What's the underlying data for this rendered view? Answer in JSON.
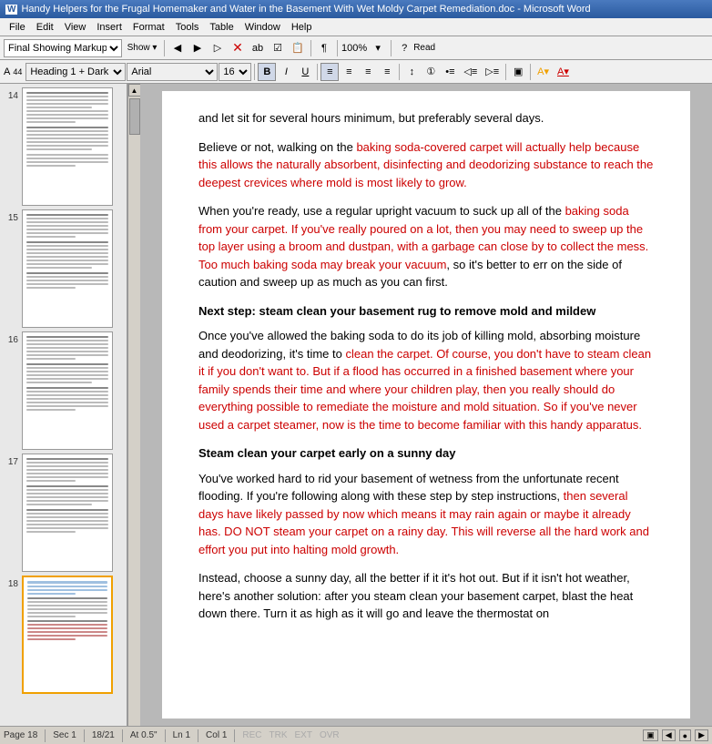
{
  "titlebar": {
    "text": "Handy Helpers for the Frugal Homemaker and Water in the Basement With Wet Moldy Carpet Remediation.doc - Microsoft Word",
    "icon": "W"
  },
  "menubar": {
    "items": [
      "File",
      "Edit",
      "View",
      "Insert",
      "Format",
      "Tools",
      "Table",
      "Window",
      "Help"
    ]
  },
  "toolbar1": {
    "dropdown_value": "Final Showing Markup",
    "show_label": "Show ▾"
  },
  "toolbar2": {
    "style_value": "Heading 1 + Dark",
    "font_value": "Arial",
    "size_value": "16",
    "bold_label": "B",
    "italic_label": "I",
    "underline_label": "U"
  },
  "pages": [
    {
      "num": "14",
      "active": false
    },
    {
      "num": "15",
      "active": false
    },
    {
      "num": "16",
      "active": false
    },
    {
      "num": "17",
      "active": false
    },
    {
      "num": "18",
      "active": true
    }
  ],
  "content": {
    "para1": "and let sit for several hours minimum, but preferably several days.",
    "para2_1": "Believe or not, walking on the baking soda-covered carpet will actually help because this allows the naturally absorbent, disinfecting and deodorizing substance to reach the deepest crevices where mold is most likely to grow.",
    "para3_1": "When you're ready, use a regular upright vacuum to suck up all of the baking soda from your carpet. If you've really poured on a lot, then you may need to sweep up the top layer using a broom and dustpan, with a garbage can close by to collect the mess. Too much baking soda may break your vacuum, so it's better to err on the side of caution and sweep up as much as you can first.",
    "heading1": "Next step: steam clean your basement rug to remove mold and mildew",
    "para4": "Once you've allowed the baking soda to do its job of killing mold, absorbing moisture and deodorizing, it's time to clean the carpet. Of course, you don't have to steam clean it if you don't want to. But if a flood has occurred in a finished basement where your family spends their time and where your children play, then you really should do everything possible to remediate the moisture and mold situation. So if you've never used a carpet steamer, now is the time to become familiar with this handy apparatus.",
    "heading2": "Steam clean your carpet early on a sunny day",
    "para5": "You've worked hard to rid your basement of wetness from the unfortunate recent flooding. If you're following along with these step by step instructions, then several days have likely passed by now which means it may rain again or maybe it already has. DO NOT steam your carpet on a rainy day. This will reverse all the hard work and effort you put into halting mold growth.",
    "para6": "Instead, choose a sunny day, all the better if it it's hot out. But if it isn't hot weather, here's another solution: after you steam clean your basement carpet, blast the heat down there. Turn it as high as it will go and leave the thermostat on"
  },
  "statusbar": {
    "page_info": "Page 18",
    "sec_info": "Sec 1",
    "pos_info": "18/21",
    "at_info": "At 0.5\"",
    "ln_info": "Ln 1",
    "col_info": "Col 1",
    "rec": "REC",
    "trk": "TRK",
    "ext": "EXT",
    "ovr": "OVR"
  }
}
